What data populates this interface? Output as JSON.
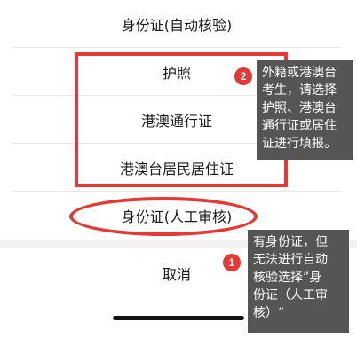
{
  "action_sheet": {
    "options": [
      {
        "label": "身份证(自动核验)"
      },
      {
        "label": "护照"
      },
      {
        "label": "港澳通行证"
      },
      {
        "label": "港澳台居民居住证"
      },
      {
        "label": "身份证(人工审核)"
      }
    ],
    "cancel_label": "取消"
  },
  "annotations": {
    "badge_1": "1",
    "badge_2": "2",
    "tip_2_lines": [
      "外籍或港澳台",
      "考生，请选择",
      "护照、港澳台",
      "通行证或居住",
      "证进行填报。"
    ],
    "tip_1_lines": [
      "有身份证，但",
      "无法进行自动",
      "核验选择”身",
      "份证（人工审",
      "核）“"
    ],
    "highlight_color": "#e53935",
    "tip_background": "#555555"
  }
}
